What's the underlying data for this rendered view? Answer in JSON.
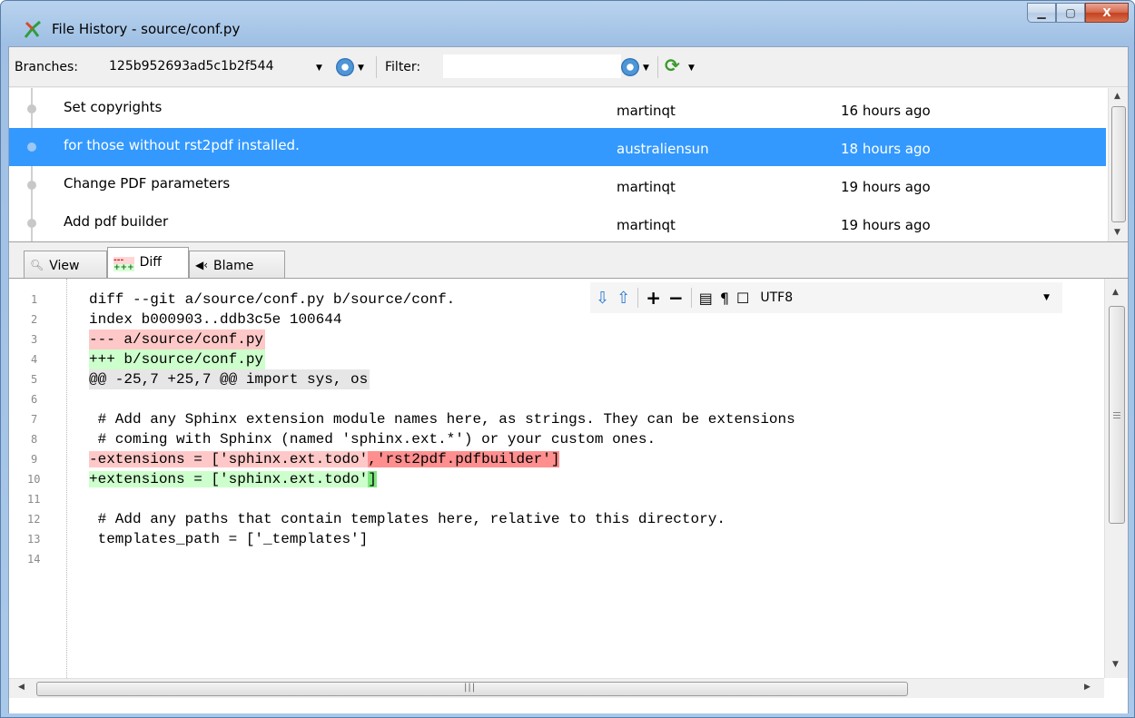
{
  "window": {
    "title": "File History - source/conf.py",
    "controls": {
      "minimize": "▁",
      "maximize": "▢",
      "close": "X"
    }
  },
  "toolbar": {
    "branches_label": "Branches:",
    "branch_value": "125b952693ad5c1b2f544",
    "filter_label": "Filter:",
    "filter_value": ""
  },
  "revisions": [
    {
      "message": "Set copyrights",
      "author": "martinqt",
      "date": "16 hours ago"
    },
    {
      "message": "for those without rst2pdf installed.",
      "author": "australiensun",
      "date": "18 hours ago"
    },
    {
      "message": "Change PDF parameters",
      "author": "martinqt",
      "date": "19 hours ago"
    },
    {
      "message": "Add pdf builder",
      "author": "martinqt",
      "date": "19 hours ago"
    }
  ],
  "tabs": [
    {
      "label": "View"
    },
    {
      "label": "Diff"
    },
    {
      "label": "Blame"
    }
  ],
  "diff_toolbar": {
    "encoding": "UTF8",
    "pilcrow": "¶"
  },
  "diff": {
    "line_numbers": [
      "1",
      "2",
      "3",
      "4",
      "5",
      "6",
      "7",
      "8",
      "9",
      "10",
      "11",
      "12",
      "13",
      "14"
    ],
    "lines": {
      "l1": "diff --git a/source/conf.py b/source/conf.",
      "l2": "index b000903..ddb3c5e 100644",
      "l3": "--- a/source/conf.py",
      "l4": "+++ b/source/conf.py",
      "l5": "@@ -25,7 +25,7 @@ import sys, os",
      "l7": " # Add any Sphinx extension module names here, as strings. They can be extensions",
      "l8": " # coming with Sphinx (named 'sphinx.ext.*') or your custom ones.",
      "l9a": "-extensions = ['sphinx.ext.todo'",
      "l9b": ",'rst2pdf.pdfbuilder']",
      "l10a": "+extensions = ['sphinx.ext.todo'",
      "l10b": "]",
      "l12": " # Add any paths that contain templates here, relative to this directory.",
      "l13": " templates_path = ['_templates']"
    }
  },
  "colors": {
    "selection": "#3399ff",
    "removed_bg": "#ffc8c8",
    "added_bg": "#ccffcc"
  }
}
